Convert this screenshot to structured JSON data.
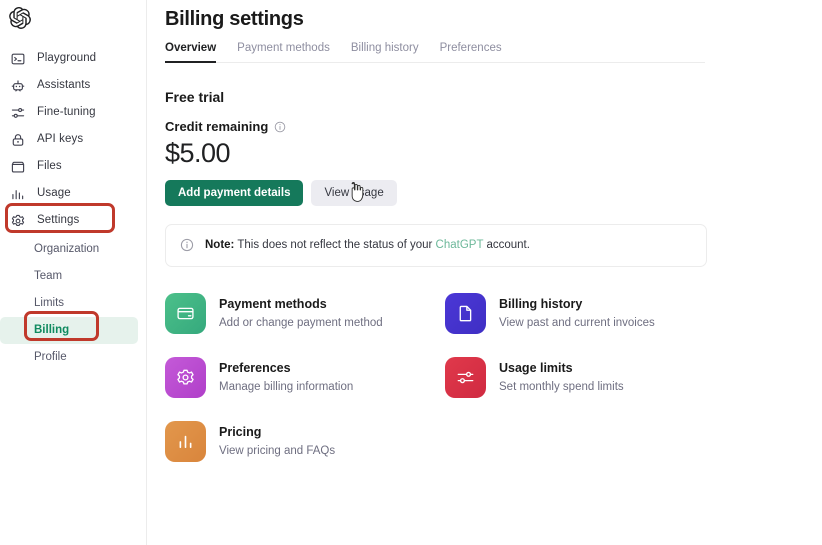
{
  "sidebar": {
    "logo": "openai-logo",
    "items": [
      {
        "label": "Playground",
        "icon": "playground-icon"
      },
      {
        "label": "Assistants",
        "icon": "assistants-icon"
      },
      {
        "label": "Fine-tuning",
        "icon": "fine-tuning-icon"
      },
      {
        "label": "API keys",
        "icon": "api-keys-icon"
      },
      {
        "label": "Files",
        "icon": "files-icon"
      },
      {
        "label": "Usage",
        "icon": "usage-icon"
      },
      {
        "label": "Settings",
        "icon": "settings-gear-icon"
      }
    ],
    "subitems": [
      {
        "label": "Organization",
        "active": false
      },
      {
        "label": "Team",
        "active": false
      },
      {
        "label": "Limits",
        "active": false
      },
      {
        "label": "Billing",
        "active": true
      },
      {
        "label": "Profile",
        "active": false
      }
    ]
  },
  "header": {
    "title": "Billing settings",
    "tabs": [
      {
        "label": "Overview",
        "active": true
      },
      {
        "label": "Payment methods",
        "active": false
      },
      {
        "label": "Billing history",
        "active": false
      },
      {
        "label": "Preferences",
        "active": false
      }
    ]
  },
  "overview": {
    "plan_title": "Free trial",
    "credit_label": "Credit remaining",
    "credit_info_icon": "info-circle-icon",
    "credit_amount": "$5.00",
    "primary_button": "Add payment details",
    "secondary_button": "View usage",
    "note": {
      "icon": "info-circle-icon",
      "bold_prefix": "Note:",
      "text_before_link": " This does not reflect the status of your ",
      "link_text": "ChatGPT",
      "text_after_link": " account."
    }
  },
  "cards": [
    {
      "title": "Payment methods",
      "subtitle": "Add or change payment method",
      "icon": "credit-card-icon",
      "color_start": "#4cc08a",
      "color_end": "#35a97d"
    },
    {
      "title": "Billing history",
      "subtitle": "View past and current invoices",
      "icon": "document-icon",
      "color_start": "#4b37d6",
      "color_end": "#3f2fc4"
    },
    {
      "title": "Preferences",
      "subtitle": "Manage billing information",
      "icon": "gear-icon",
      "color_start": "#c45ad8",
      "color_end": "#b03fc9"
    },
    {
      "title": "Usage limits",
      "subtitle": "Set monthly spend limits",
      "icon": "sliders-icon",
      "color_start": "#e0394b",
      "color_end": "#d02a41"
    },
    {
      "title": "Pricing",
      "subtitle": "View pricing and FAQs",
      "icon": "bar-chart-icon",
      "color_start": "#e2974c",
      "color_end": "#d9853c"
    }
  ],
  "annotations": {
    "color": "#c0392b",
    "settings_box": "settings-highlight",
    "billing_box": "billing-highlight"
  },
  "cursor": {
    "type": "pointer-hand-cursor"
  }
}
